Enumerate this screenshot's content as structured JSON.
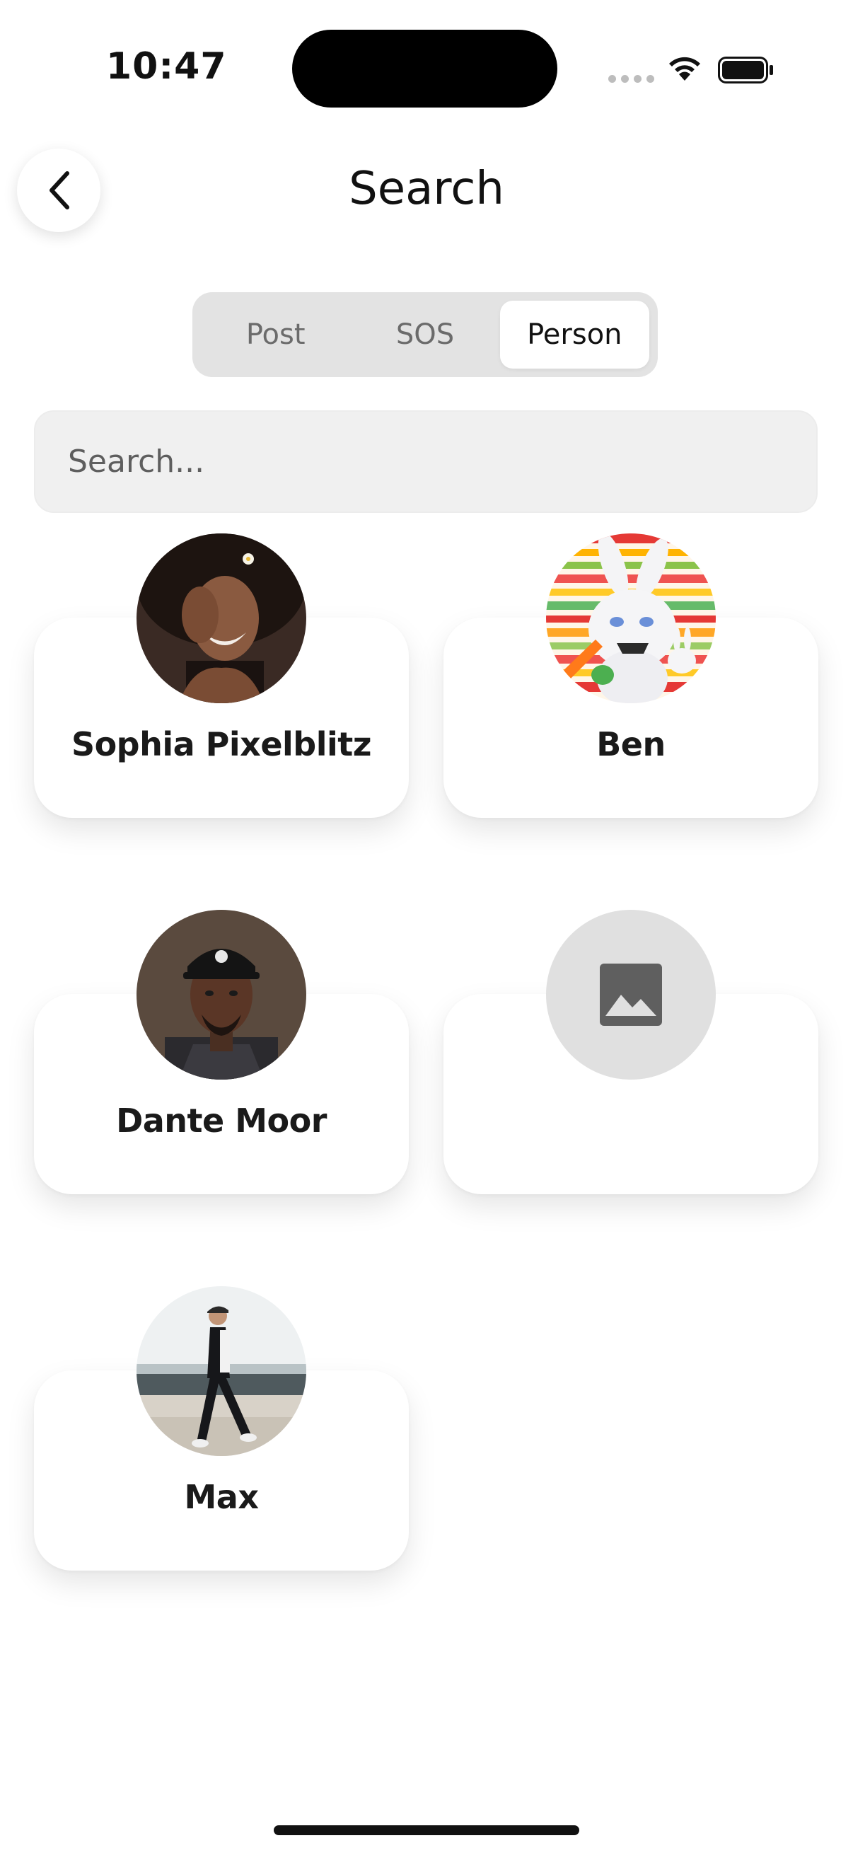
{
  "status_bar": {
    "time": "10:47"
  },
  "header": {
    "title": "Search"
  },
  "tabs": [
    {
      "label": "Post",
      "active": false
    },
    {
      "label": "SOS",
      "active": false
    },
    {
      "label": "Person",
      "active": true
    }
  ],
  "search": {
    "placeholder": "Search..."
  },
  "people": [
    {
      "name": "Sophia Pixelblitz",
      "avatar": "photo-woman-laughing"
    },
    {
      "name": "Ben",
      "avatar": "photo-angry-bunny-toy"
    },
    {
      "name": "Dante Moor",
      "avatar": "photo-man-cap"
    },
    {
      "name": "",
      "avatar": "image-placeholder-icon"
    },
    {
      "name": "Max",
      "avatar": "photo-man-walking-beach"
    }
  ]
}
